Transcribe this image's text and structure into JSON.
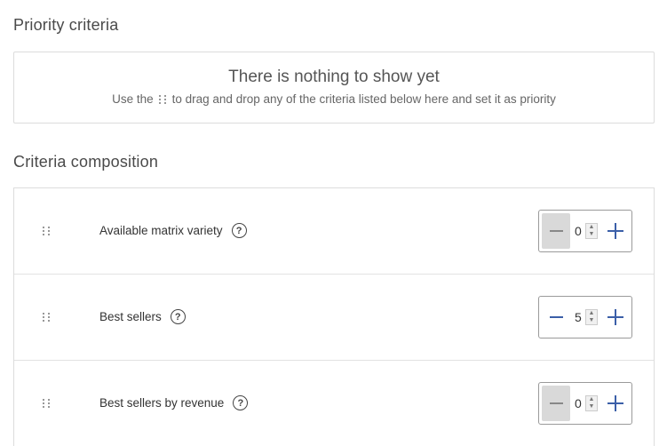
{
  "priority": {
    "title": "Priority criteria",
    "empty_title": "There is nothing to show yet",
    "hint_before": "Use the",
    "hint_after": "to drag and drop any of the criteria listed below here and set it as priority"
  },
  "composition": {
    "title": "Criteria composition",
    "rows": [
      {
        "label": "Available matrix variety",
        "value": "0",
        "minus_disabled": true
      },
      {
        "label": "Best sellers",
        "value": "5",
        "minus_disabled": false
      },
      {
        "label": "Best sellers by revenue",
        "value": "0",
        "minus_disabled": true
      }
    ]
  },
  "icons": {
    "drag": "drag-handle-icon",
    "help": "help-circle-icon",
    "minus": "minus-icon",
    "plus": "plus-icon"
  },
  "help_glyph": "?",
  "colors": {
    "accent": "#3b5fa8",
    "border": "#dcdcdc",
    "disabled": "#d9d9d9"
  }
}
